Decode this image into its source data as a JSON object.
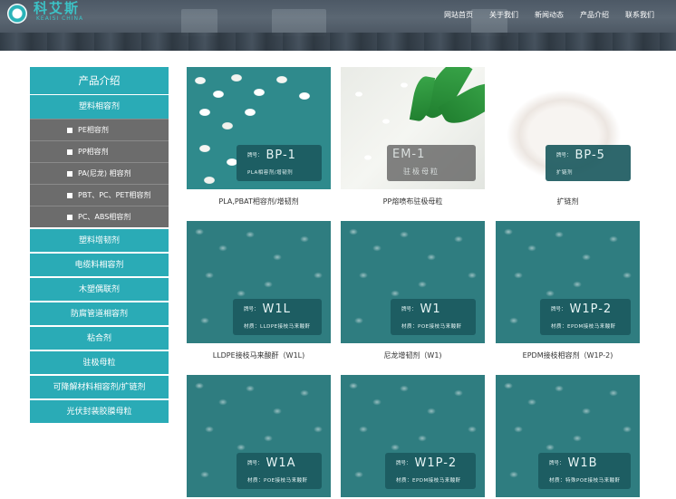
{
  "logo": {
    "name": "科艾斯",
    "sub": "KEAISI CHINA"
  },
  "nav": [
    "网站首页",
    "关于我们",
    "新闻动态",
    "产品介绍",
    "联系我们"
  ],
  "sidebar": {
    "title": "产品介绍",
    "items": [
      {
        "label": "塑料相容剂"
      },
      {
        "label": "PE相容剂",
        "sub": true
      },
      {
        "label": "PP相容剂",
        "sub": true
      },
      {
        "label": "PA(尼龙) 相容剂",
        "sub": true
      },
      {
        "label": "PBT、PC、PET相容剂",
        "sub": true
      },
      {
        "label": "PC、ABS相容剂",
        "sub": true
      },
      {
        "label": "塑料增韧剂"
      },
      {
        "label": "电缆料相容剂"
      },
      {
        "label": "木塑偶联剂"
      },
      {
        "label": "防腐管道相容剂"
      },
      {
        "label": "粘合剂"
      },
      {
        "label": "驻极母粒"
      },
      {
        "label": "可降解材料相容剂/扩链剂"
      },
      {
        "label": "光伏封装胶膜母粒"
      }
    ]
  },
  "products": [
    {
      "caption": "PLA,PBAT相容剂/增韧剂",
      "tag_prefix": "牌号：",
      "tag_code": "BP-1",
      "tag_desc": "PLA相容剂/增韧剂",
      "style": "white-pellets"
    },
    {
      "caption": "PP熔喷布驻极母粒",
      "tag_prefix": "",
      "tag_code": "EM-1",
      "tag_desc": "驻极母粒",
      "style": "pp-bg"
    },
    {
      "caption": "扩链剂",
      "tag_prefix": "牌号：",
      "tag_code": "BP-5",
      "tag_desc": "扩链剂",
      "style": "powder"
    },
    {
      "caption": "LLDPE接枝马来酸酐（W1L)",
      "tag_prefix": "牌号：",
      "tag_code": "W1L",
      "tag_desc": "材质：LLDPE接枝马来酸酐",
      "style": "teal"
    },
    {
      "caption": "尼龙增韧剂（W1)",
      "tag_prefix": "牌号：",
      "tag_code": "W1",
      "tag_desc": "材质：POE接枝马来酸酐",
      "style": "teal"
    },
    {
      "caption": "EPDM接枝相容剂（W1P-2)",
      "tag_prefix": "牌号：",
      "tag_code": "W1P-2",
      "tag_desc": "材质：EPDM接枝马来酸酐",
      "style": "teal"
    },
    {
      "caption": "",
      "tag_prefix": "牌号：",
      "tag_code": "W1A",
      "tag_desc": "材质：POE接枝马来酸酐",
      "style": "teal"
    },
    {
      "caption": "",
      "tag_prefix": "牌号：",
      "tag_code": "W1P-2",
      "tag_desc": "材质：EPDM接枝马来酸酐",
      "style": "teal"
    },
    {
      "caption": "",
      "tag_prefix": "牌号：",
      "tag_code": "W1B",
      "tag_desc": "材质：特殊POE接枝马来酸酐",
      "style": "teal"
    }
  ],
  "colors": {
    "accent": "#2aabb6",
    "submenu": "#6c6c6c",
    "header": "#4d5966"
  }
}
